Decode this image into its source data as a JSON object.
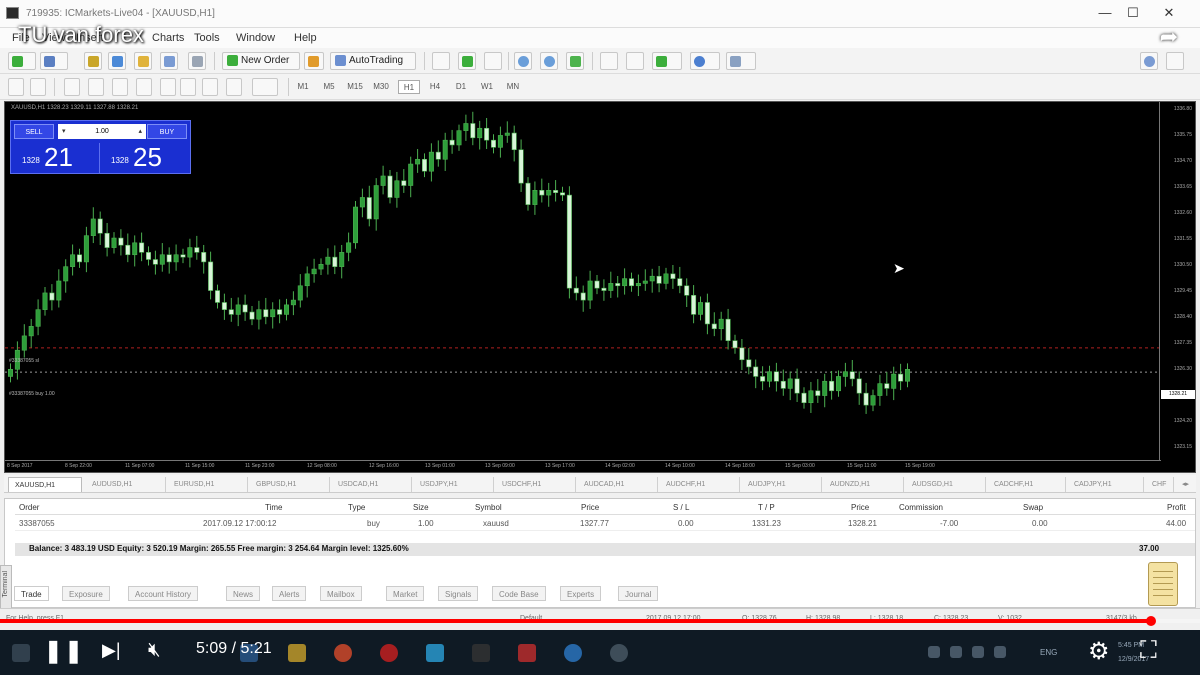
{
  "window": {
    "title": "719935: ICMarkets-Live04 - [XAUUSD,H1]",
    "min": "—",
    "max": "☐",
    "close": "✕"
  },
  "overlay": {
    "title": "TU van forex",
    "share_icon": "share-icon"
  },
  "menu": [
    "File",
    "View",
    "Insert",
    "Charts",
    "Tools",
    "Window",
    "Help"
  ],
  "toolbar": {
    "new_order": "New Order",
    "autotrading": "AutoTrading",
    "timeframes": [
      "M1",
      "M5",
      "M15",
      "M30",
      "H1",
      "H4",
      "D1",
      "W1",
      "MN"
    ]
  },
  "chart": {
    "symbol_info": "XAUUSD,H1  1328.23 1329.11 1327.88 1328.21",
    "trade_panel": {
      "sell": "SELL",
      "buy": "BUY",
      "lot": "1.00",
      "minus": "▾",
      "plus": "▴",
      "sell_price_small": "1328",
      "sell_price_large": "21",
      "buy_price_small": "1328",
      "buy_price_large": "25"
    },
    "sl_label": "#33387055 sl",
    "entry_label": "#33387055 buy 1.00",
    "current_price": "1328.21",
    "y_labels": [
      "1336.80",
      "1335.75",
      "1334.70",
      "1333.65",
      "1332.60",
      "1331.55",
      "1330.50",
      "1329.45",
      "1328.40",
      "1327.35",
      "1326.30",
      "1325.25",
      "1324.20",
      "1323.15"
    ],
    "x_labels": [
      "8 Sep 2017",
      "8 Sep 22:00",
      "11 Sep 07:00",
      "11 Sep 15:00",
      "11 Sep 23:00",
      "12 Sep 08:00",
      "12 Sep 16:00",
      "13 Sep 01:00",
      "13 Sep 09:00",
      "13 Sep 17:00",
      "14 Sep 02:00",
      "14 Sep 10:00",
      "14 Sep 18:00",
      "15 Sep 03:00",
      "15 Sep 11:00",
      "15 Sep 19:00"
    ]
  },
  "symbol_tabs": [
    "XAUUSD,H1",
    "AUDUSD,H1",
    "EURUSD,H1",
    "GBPUSD,H1",
    "USDCAD,H1",
    "USDJPY,H1",
    "USDCHF,H1",
    "AUDCAD,H1",
    "AUDCHF,H1",
    "AUDJPY,H1",
    "AUDNZD,H1",
    "AUDSGD,H1",
    "CADCHF,H1",
    "CADJPY,H1",
    "CHF"
  ],
  "terminal": {
    "columns": [
      "Order",
      "Time",
      "Type",
      "Size",
      "Symbol",
      "Price",
      "S / L",
      "T / P",
      "Price",
      "Commission",
      "Swap",
      "Profit"
    ],
    "row": [
      "33387055",
      "2017.09.12 17:00:12",
      "buy",
      "1.00",
      "xauusd",
      "1327.77",
      "0.00",
      "1331.23",
      "1328.21",
      "-7.00",
      "0.00",
      "44.00"
    ],
    "balance_line": "Balance: 3 483.19 USD  Equity: 3 520.19  Margin: 265.55  Free margin: 3 254.64  Margin level: 1325.60%",
    "total": "37.00",
    "side_label": "Terminal"
  },
  "bottom_tabs": [
    "Trade",
    "Exposure",
    "Account History",
    "News",
    "Alerts",
    "Mailbox",
    "Market",
    "Signals",
    "Code Base",
    "Experts",
    "Journal"
  ],
  "status": {
    "help": "For Help, press F1",
    "profile": "Default",
    "datetime": "2017.09.12 17:00",
    "o": "O: 1328.76",
    "h": "H: 1328.98",
    "l": "L: 1328.18",
    "c": "C: 1328.23",
    "v": "V: 1032",
    "kb": "3147/3 kb"
  },
  "player": {
    "progress": 0.959,
    "time": "5:09 / 5:21",
    "play_icon": "pause-icon",
    "next_icon": "next-icon",
    "volume_icon": "mute-icon",
    "settings_icon": "gear-icon",
    "fullscreen_icon": "fullscreen-icon"
  },
  "taskbar": {
    "lang": "ENG",
    "time": "5:45 PM",
    "date": "12/9/2017"
  },
  "chart_data": {
    "type": "candlestick",
    "closes": [
      1326.1,
      1326.9,
      1327.5,
      1327.9,
      1328.6,
      1329.3,
      1329.0,
      1329.8,
      1330.4,
      1330.9,
      1330.6,
      1331.7,
      1332.4,
      1331.8,
      1331.2,
      1331.6,
      1331.3,
      1330.9,
      1331.4,
      1331.0,
      1330.7,
      1330.5,
      1330.9,
      1330.6,
      1330.9,
      1330.8,
      1331.2,
      1331.0,
      1330.6,
      1329.4,
      1328.9,
      1328.6,
      1328.4,
      1328.8,
      1328.5,
      1328.2,
      1328.6,
      1328.3,
      1328.6,
      1328.4,
      1328.8,
      1329.0,
      1329.6,
      1330.1,
      1330.3,
      1330.5,
      1330.8,
      1330.4,
      1331.0,
      1331.4,
      1332.9,
      1333.3,
      1332.4,
      1333.8,
      1334.2,
      1333.3,
      1334.0,
      1333.8,
      1334.7,
      1334.9,
      1334.4,
      1335.2,
      1334.9,
      1335.7,
      1335.5,
      1336.1,
      1336.4,
      1335.8,
      1336.2,
      1335.7,
      1335.4,
      1335.9,
      1336.0,
      1335.3,
      1333.9,
      1333.0,
      1333.6,
      1333.4,
      1333.6,
      1333.5,
      1333.4,
      1329.5,
      1329.3,
      1329.0,
      1329.8,
      1329.5,
      1329.4,
      1329.7,
      1329.6,
      1329.9,
      1329.6,
      1329.7,
      1329.8,
      1330.0,
      1329.7,
      1330.1,
      1329.9,
      1329.6,
      1329.2,
      1328.4,
      1328.9,
      1328.0,
      1327.8,
      1328.2,
      1327.3,
      1327.0,
      1326.5,
      1326.2,
      1325.8,
      1325.6,
      1326.0,
      1325.6,
      1325.3,
      1325.7,
      1325.1,
      1324.7,
      1325.2,
      1325.0,
      1325.6,
      1325.2,
      1325.8,
      1326.0,
      1325.7,
      1325.1,
      1324.6,
      1325.0,
      1325.5,
      1325.3,
      1325.9,
      1325.6,
      1326.1
    ],
    "sl_level": 1327.0,
    "entry_level": 1325.98,
    "current": 1326.1
  }
}
